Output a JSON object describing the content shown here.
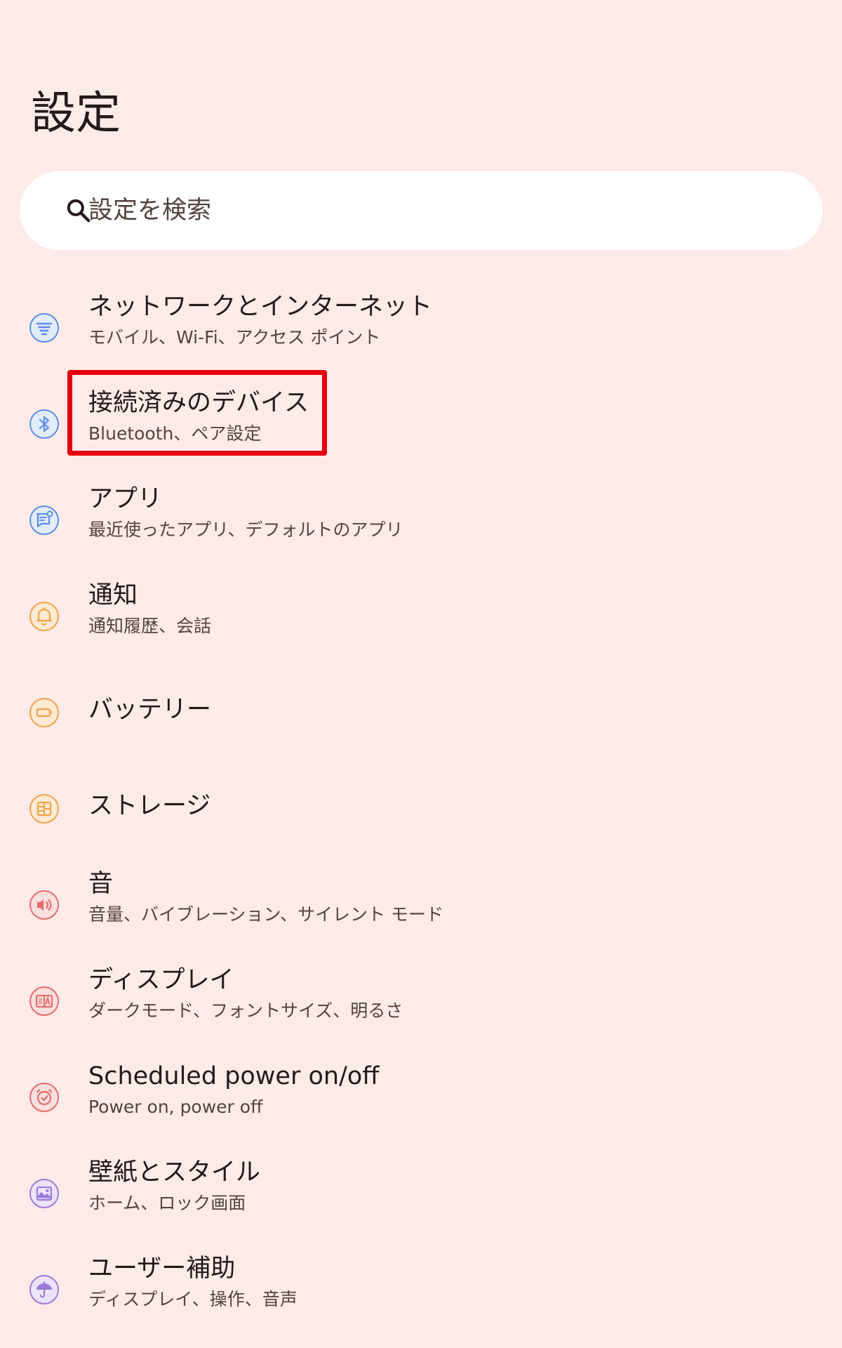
{
  "header": {
    "title": "設定"
  },
  "search": {
    "placeholder": "設定を検索",
    "icon": "search-icon"
  },
  "settings": {
    "items": [
      {
        "title": "ネットワークとインターネット",
        "subtitle": "モバイル、Wi-Fi、アクセス ポイント",
        "icon": "wifi-icon",
        "icon_color": "#5b8ee6"
      },
      {
        "title": "接続済みのデバイス",
        "subtitle": "Bluetooth、ペア設定",
        "icon": "bluetooth-icon",
        "icon_color": "#5b8ee6"
      },
      {
        "title": "アプリ",
        "subtitle": "最近使ったアプリ、デフォルトのアプリ",
        "icon": "apps-icon",
        "icon_color": "#5b8ee6"
      },
      {
        "title": "通知",
        "subtitle": "通知履歴、会話",
        "icon": "bell-icon",
        "icon_color": "#f2a34a"
      },
      {
        "title": "バッテリー",
        "subtitle": "",
        "icon": "battery-icon",
        "icon_color": "#f2a34a"
      },
      {
        "title": "ストレージ",
        "subtitle": "",
        "icon": "storage-icon",
        "icon_color": "#f2a34a"
      },
      {
        "title": "音",
        "subtitle": "音量、バイブレーション、サイレント モード",
        "icon": "volume-icon",
        "icon_color": "#e96a6a"
      },
      {
        "title": "ディスプレイ",
        "subtitle": "ダークモード、フォントサイズ、明るさ",
        "icon": "display-icon",
        "icon_color": "#e96a6a"
      },
      {
        "title": "Scheduled power on/off",
        "subtitle": "Power on, power off",
        "icon": "clock-icon",
        "icon_color": "#e96a6a"
      },
      {
        "title": "壁紙とスタイル",
        "subtitle": "ホーム、ロック画面",
        "icon": "wallpaper-icon",
        "icon_color": "#9c7ad8"
      },
      {
        "title": "ユーザー補助",
        "subtitle": "ディスプレイ、操作、音声",
        "icon": "accessibility-icon",
        "icon_color": "#9c7ad8"
      }
    ]
  },
  "annotation": {
    "highlight_color": "#e5000f"
  }
}
